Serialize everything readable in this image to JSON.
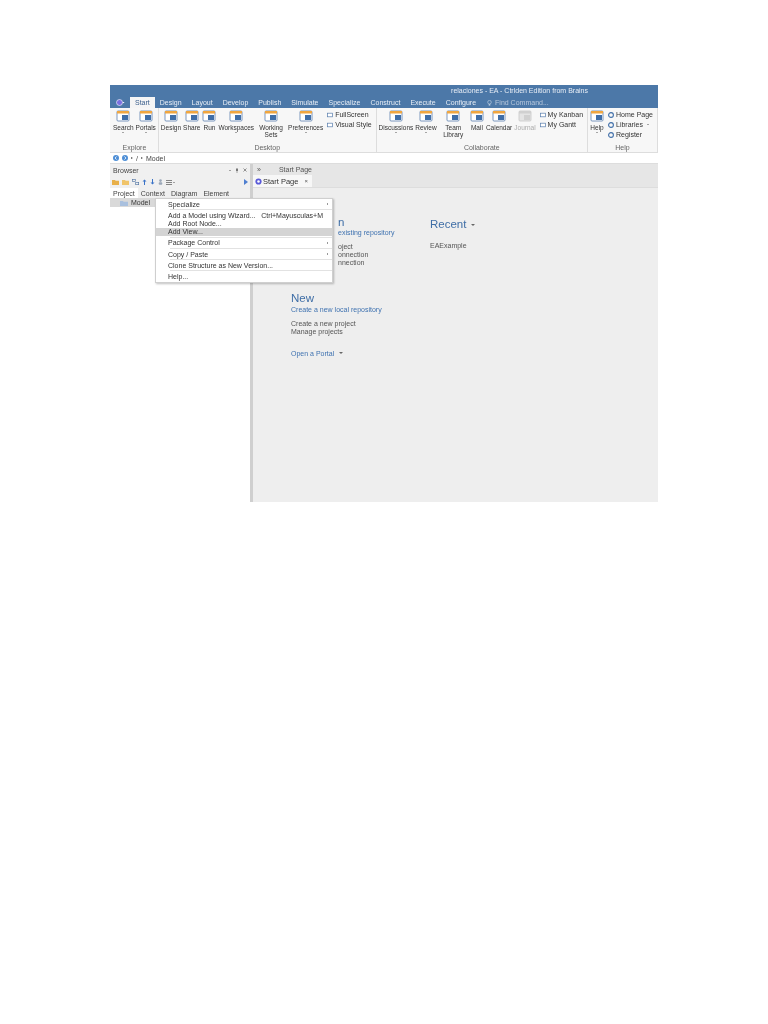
{
  "window": {
    "title": "relaciones - EA - Ctrlden Edition from Brains"
  },
  "ribbon_tabs": [
    {
      "label": "Start",
      "selected": true
    },
    {
      "label": "Design",
      "selected": false
    },
    {
      "label": "Layout",
      "selected": false
    },
    {
      "label": "Develop",
      "selected": false
    },
    {
      "label": "Publish",
      "selected": false
    },
    {
      "label": "Simulate",
      "selected": false
    },
    {
      "label": "Specialize",
      "selected": false
    },
    {
      "label": "Construct",
      "selected": false
    },
    {
      "label": "Execute",
      "selected": false
    },
    {
      "label": "Configure",
      "selected": false
    }
  ],
  "command_search": {
    "placeholder": "Find Command..."
  },
  "ribbon_groups": [
    {
      "name": "Explore",
      "items": [
        {
          "label": "Search",
          "kind": "large",
          "dropdown": true,
          "disabled": false
        },
        {
          "label": "Portals",
          "kind": "large",
          "dropdown": true,
          "disabled": false
        }
      ]
    },
    {
      "name": "Desktop",
      "items": [
        {
          "label": "Design",
          "kind": "large",
          "dropdown": false,
          "disabled": false
        },
        {
          "label": "Share",
          "kind": "large",
          "dropdown": false,
          "disabled": false
        },
        {
          "label": "Run",
          "kind": "large",
          "dropdown": false,
          "disabled": false
        },
        {
          "label": "Workspaces",
          "kind": "large",
          "dropdown": true,
          "disabled": false
        },
        {
          "label": "Working Sets",
          "kind": "large",
          "dropdown": false,
          "disabled": false
        },
        {
          "label": "Preferences",
          "kind": "large",
          "dropdown": true,
          "disabled": false
        },
        {
          "label": "FullScreen",
          "kind": "small",
          "dropdown": false,
          "disabled": false
        },
        {
          "label": "Visual Style",
          "kind": "small",
          "dropdown": false,
          "disabled": false
        }
      ]
    },
    {
      "name": "Collaborate",
      "items": [
        {
          "label": "Discussions",
          "kind": "large",
          "dropdown": true,
          "disabled": false
        },
        {
          "label": "Review",
          "kind": "large",
          "dropdown": true,
          "disabled": false
        },
        {
          "label": "Team Library",
          "kind": "large",
          "dropdown": false,
          "disabled": false
        },
        {
          "label": "Mail",
          "kind": "large",
          "dropdown": false,
          "disabled": false
        },
        {
          "label": "Calendar",
          "kind": "large",
          "dropdown": false,
          "disabled": false
        },
        {
          "label": "Journal",
          "kind": "large",
          "dropdown": false,
          "disabled": true
        },
        {
          "label": "My Kanban",
          "kind": "small",
          "dropdown": false,
          "disabled": false
        },
        {
          "label": "My Gantt",
          "kind": "small",
          "dropdown": false,
          "disabled": false
        }
      ]
    },
    {
      "name": "Help",
      "items": [
        {
          "label": "Help",
          "kind": "large",
          "dropdown": true,
          "disabled": false
        },
        {
          "label": "Home Page",
          "kind": "small",
          "dropdown": false,
          "disabled": false
        },
        {
          "label": "Libraries",
          "kind": "small",
          "dropdown": true,
          "disabled": false
        },
        {
          "label": "Register",
          "kind": "small",
          "dropdown": false,
          "disabled": false
        }
      ]
    }
  ],
  "address": {
    "path": [
      "/",
      "Model"
    ]
  },
  "browser": {
    "title": "Browser",
    "tabs": [
      {
        "label": "Project",
        "selected": true
      },
      {
        "label": "Context",
        "selected": false
      },
      {
        "label": "Diagram",
        "selected": false
      },
      {
        "label": "Element",
        "selected": false
      }
    ],
    "tree": [
      {
        "label": "Model",
        "selected": true
      }
    ]
  },
  "context_menu": [
    {
      "kind": "item",
      "label": "Specialize",
      "submenu": true,
      "selected": false
    },
    {
      "kind": "separator"
    },
    {
      "kind": "item",
      "label": "Add a Model using Wizard...",
      "shortcut": "Ctrl+Mayusculas+M",
      "submenu": false,
      "selected": false
    },
    {
      "kind": "item",
      "label": "Add Root Node...",
      "submenu": false,
      "selected": false
    },
    {
      "kind": "item",
      "label": "Add View...",
      "submenu": false,
      "selected": true
    },
    {
      "kind": "separator"
    },
    {
      "kind": "item",
      "label": "Package Control",
      "submenu": true,
      "selected": false
    },
    {
      "kind": "separator"
    },
    {
      "kind": "item",
      "label": "Copy / Paste",
      "submenu": true,
      "selected": false
    },
    {
      "kind": "separator"
    },
    {
      "kind": "item",
      "label": "Clone Structure as New Version...",
      "submenu": false,
      "selected": false
    },
    {
      "kind": "separator"
    },
    {
      "kind": "item",
      "label": "Help...",
      "submenu": false,
      "selected": false
    }
  ],
  "document": {
    "expander": "»",
    "crumb": "Start Page",
    "tabs": [
      {
        "label": "Start Page",
        "selected": true,
        "close": "×"
      }
    ]
  },
  "start_page": {
    "open": {
      "heading": "n",
      "link": "existing repository",
      "items": [
        "oject",
        "onnection",
        "nnection"
      ]
    },
    "recent": {
      "heading": "Recent",
      "items": [
        "EAExample"
      ]
    },
    "new": {
      "heading": "New",
      "link": "Create a new local repository",
      "items": [
        "Create a new project",
        "Manage projects"
      ]
    },
    "portal": "Open a Portal"
  }
}
